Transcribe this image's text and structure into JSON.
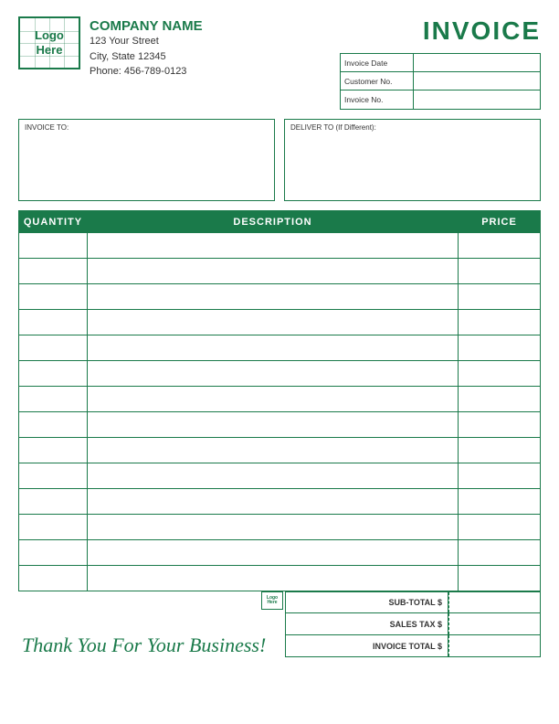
{
  "header": {
    "logo": {
      "line1": "Logo",
      "line2": "Here"
    },
    "company": {
      "name": "COMPANY NAME",
      "address1": "123 Your Street",
      "address2": "City, State 12345",
      "phone": "Phone: 456-789-0123"
    },
    "invoice_title": "INVOICE",
    "fields": [
      {
        "label": "Invoice Date",
        "value": ""
      },
      {
        "label": "Customer No.",
        "value": ""
      },
      {
        "label": "Invoice No.",
        "value": ""
      }
    ]
  },
  "address": {
    "invoice_to_label": "INVOICE TO:",
    "deliver_to_label": "DELIVER TO (If Different):"
  },
  "table": {
    "columns": [
      "QUANTITY",
      "DESCRIPTION",
      "PRICE"
    ],
    "rows": 14
  },
  "footer": {
    "thank_you": "Thank You For Your Business!",
    "totals": [
      {
        "label": "SUB-TOTAL $",
        "value": ""
      },
      {
        "label": "SALES TAX $",
        "value": ""
      },
      {
        "label": "INVOICE TOTAL $",
        "value": ""
      }
    ]
  }
}
